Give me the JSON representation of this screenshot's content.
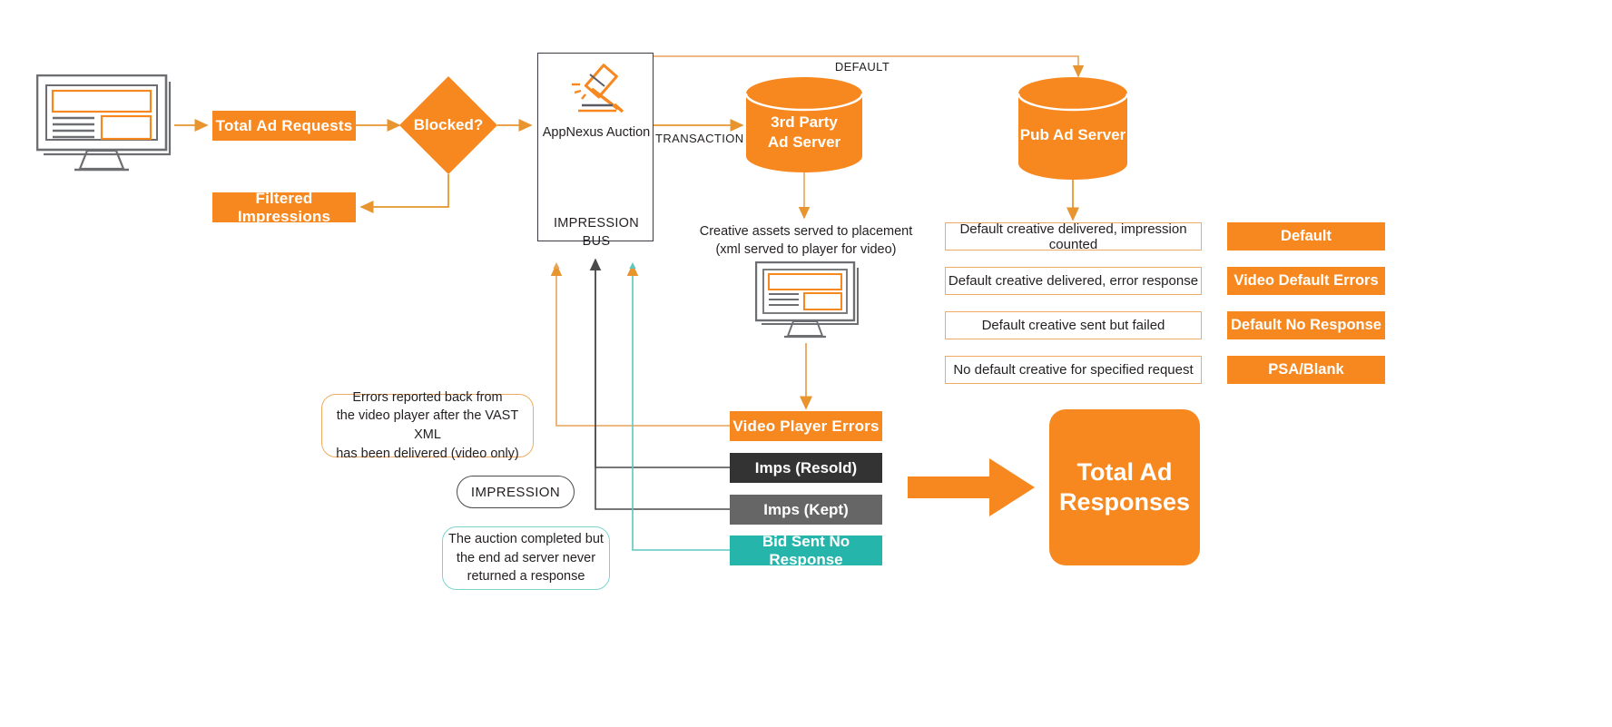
{
  "diagram": {
    "title": "AppNexus ad request and impression flow",
    "colors": {
      "orange": "#f7881f",
      "orange_line": "#e8a459",
      "dark": "#333333",
      "gray": "#666666",
      "teal": "#26b5ab",
      "teal_line": "#7fd4ce",
      "outline": "#eeab61",
      "monitor_gray": "#6d6e71"
    }
  },
  "flow": {
    "monitor_left": {
      "name": "publisher-page-monitor"
    },
    "total_ad_requests": "Total Ad Requests",
    "blocked_decision": "Blocked?",
    "filtered_impressions": "Filtered Impressions",
    "impression_bus": {
      "auction_label": "AppNexus Auction",
      "bus_label": "IMPRESSION BUS",
      "icon": "gavel-icon"
    },
    "transaction_label": "TRANSACTION",
    "default_label": "DEFAULT",
    "third_party_ad_server": "3rd Party\nAd Server",
    "third_party_ad_server_line1": "3rd Party",
    "third_party_ad_server_line2": "Ad Server",
    "pub_ad_server": "Pub Ad Server",
    "creative_assets_note_line1": "Creative assets served to placement",
    "creative_assets_note_line2": "(xml served to player for video)",
    "monitor_placement": {
      "name": "placement-monitor"
    }
  },
  "default_outcomes": [
    "Default creative delivered, impression counted",
    "Default creative delivered, error response",
    "Default creative sent but failed",
    "No default creative for specified request"
  ],
  "legend": [
    "Default",
    "Video Default Errors",
    "Default No Response",
    "PSA/Blank"
  ],
  "callouts": {
    "video_errors": {
      "line1": "Errors reported back from",
      "line2": "the video player after the VAST XML",
      "line3": "has been delivered (video only)"
    },
    "impression_pill": "IMPRESSION",
    "no_response": {
      "line1": "The auction completed but",
      "line2": "the end ad server never",
      "line3": "returned a response"
    }
  },
  "outcome_bars": [
    {
      "label": "Video Player Errors",
      "style": "orange"
    },
    {
      "label": "Imps (Resold)",
      "style": "dark"
    },
    {
      "label": "Imps (Kept)",
      "style": "gray"
    },
    {
      "label": "Bid Sent No Response",
      "style": "teal"
    }
  ],
  "total": {
    "line1": "Total Ad",
    "line2": "Responses"
  }
}
